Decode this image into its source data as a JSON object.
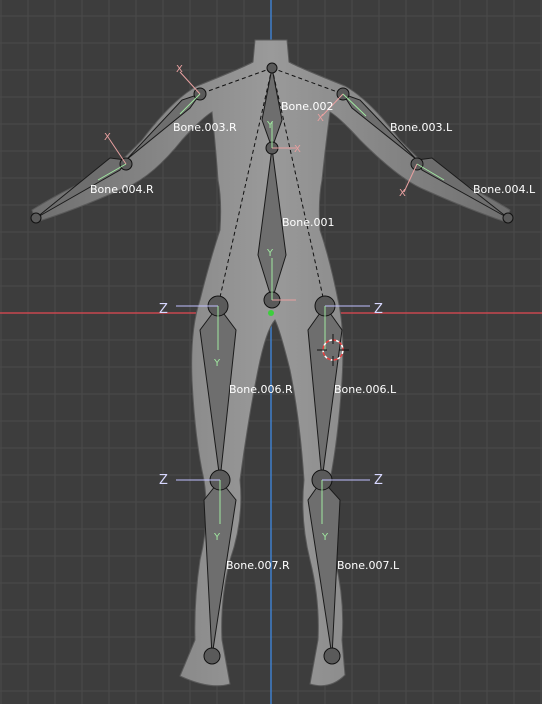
{
  "viewport": {
    "background": "#3d3d3d",
    "grid_color": "#4a4a4a",
    "x_axis_color": "#c8474f",
    "y_axis_color": "#3f7fcc"
  },
  "bone_labels": {
    "bone_001": "Bone.001",
    "bone_002": "Bone.002",
    "bone_003_r": "Bone.003.R",
    "bone_003_l": "Bone.003.L",
    "bone_004_r": "Bone.004.R",
    "bone_004_l": "Bone.004.L",
    "bone_006_r": "Bone.006.R",
    "bone_006_l": "Bone.006.L",
    "bone_007_r": "Bone.007.R",
    "bone_007_l": "Bone.007.L"
  },
  "axis_letters": {
    "x": "X",
    "y": "Y",
    "z": "Z"
  },
  "colors": {
    "body_fill": "#8a8a8a",
    "bone_fill": "#6e6e6e",
    "bone_outline": "#1a1a1a",
    "axis_x": "#e8a0a0",
    "axis_y": "#a0e8a0",
    "axis_z": "#c0c0ff"
  }
}
